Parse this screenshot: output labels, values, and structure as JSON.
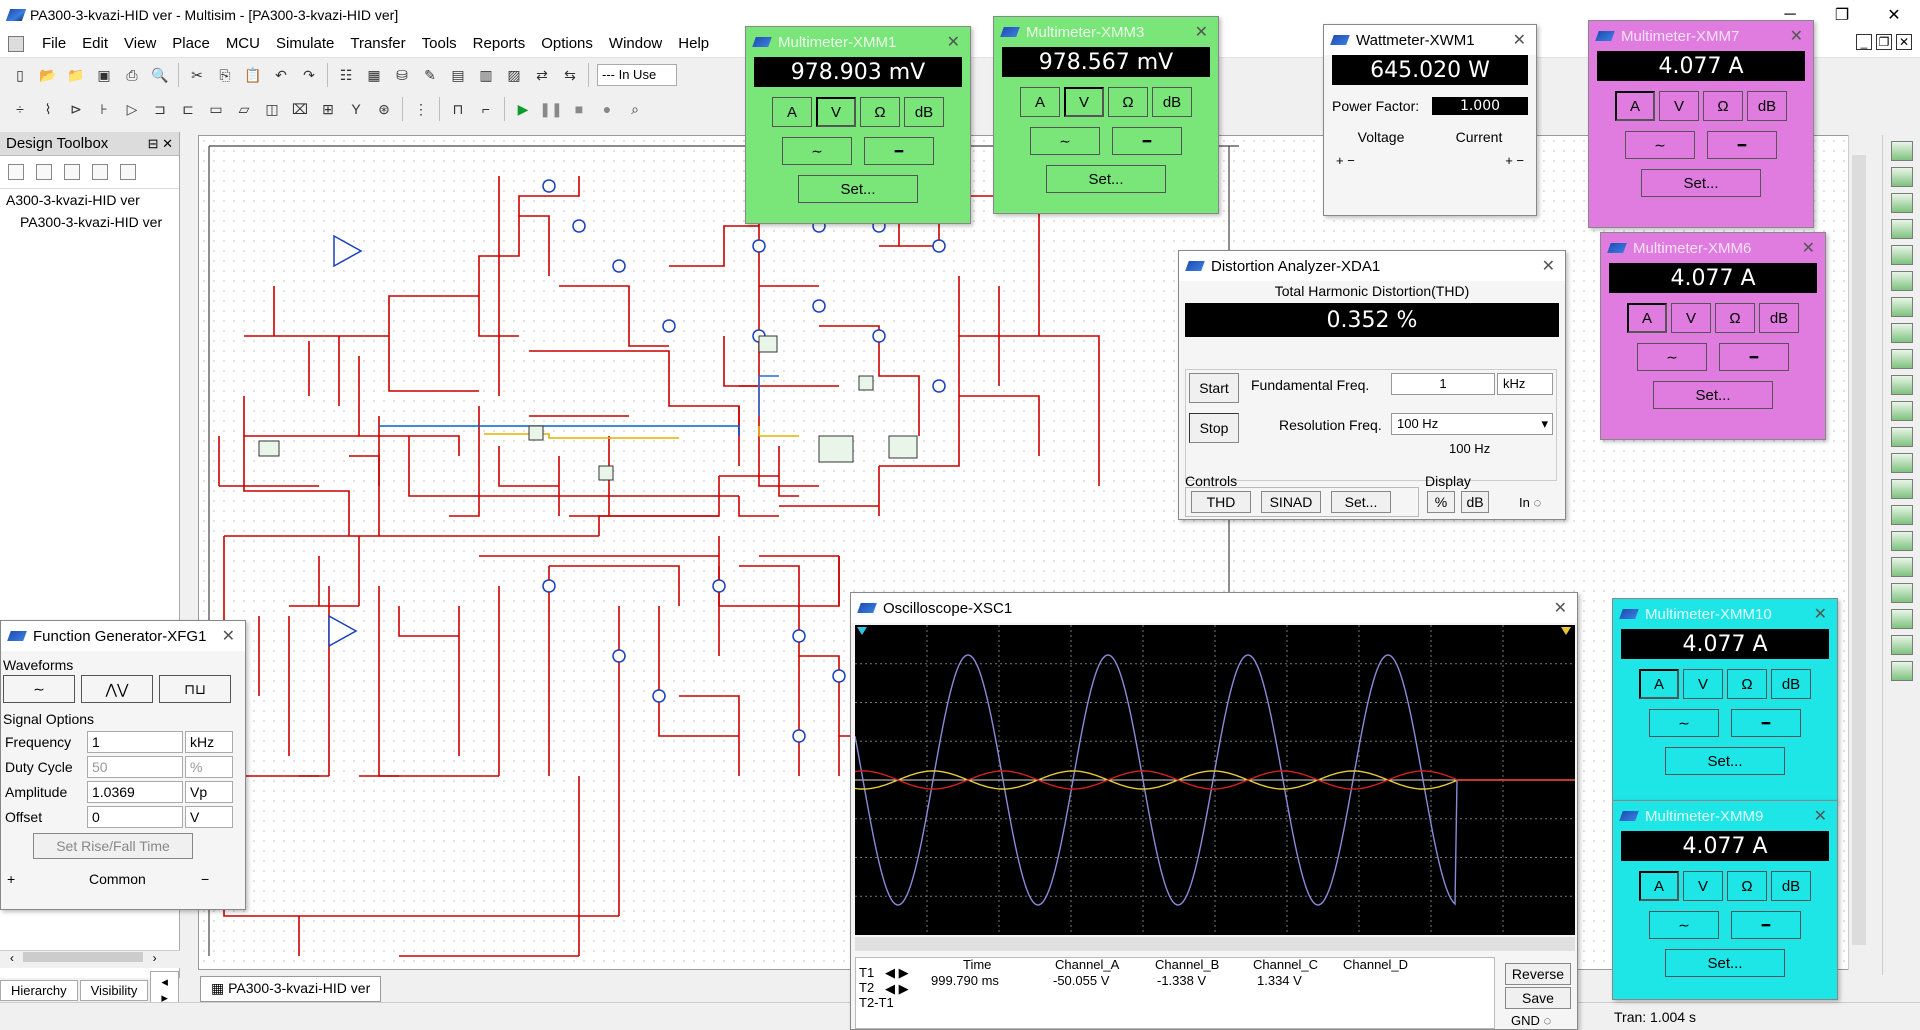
{
  "window": {
    "title": "PA300-3-kvazi-HID ver - Multisim - [PA300-3-kvazi-HID ver]"
  },
  "menu": [
    "File",
    "Edit",
    "View",
    "Place",
    "MCU",
    "Simulate",
    "Transfer",
    "Tools",
    "Reports",
    "Options",
    "Window",
    "Help"
  ],
  "toolbar": {
    "in_use": "--- In Use"
  },
  "toolbox": {
    "title": "Design Toolbox",
    "items": [
      "A300-3-kvazi-HID ver",
      "PA300-3-kvazi-HID ver"
    ],
    "tabs": [
      "Hierarchy",
      "Visibility"
    ]
  },
  "document_tab": "PA300-3-kvazi-HID ver",
  "status": {
    "tran": "Tran: 1.004 s"
  },
  "multimeters": {
    "xmm1": {
      "title": "Multimeter-XMM1",
      "reading": "978.903 mV",
      "set": "Set..."
    },
    "xmm3": {
      "title": "Multimeter-XMM3",
      "reading": "978.567 mV",
      "set": "Set..."
    },
    "xmm7": {
      "title": "Multimeter-XMM7",
      "reading": "4.077 A",
      "set": "Set..."
    },
    "xmm6": {
      "title": "Multimeter-XMM6",
      "reading": "4.077 A",
      "set": "Set..."
    },
    "xmm10": {
      "title": "Multimeter-XMM10",
      "reading": "4.077 A",
      "set": "Set..."
    },
    "xmm9": {
      "title": "Multimeter-XMM9",
      "reading": "4.077 A",
      "set": "Set..."
    },
    "mode_labels": [
      "A",
      "V",
      "Ω",
      "dB"
    ]
  },
  "wattmeter": {
    "title": "Wattmeter-XWM1",
    "reading": "645.020 W",
    "power_factor_label": "Power Factor:",
    "power_factor": "1.000",
    "voltage_label": "Voltage",
    "current_label": "Current"
  },
  "distortion": {
    "title": "Distortion Analyzer-XDA1",
    "thd_label": "Total Harmonic Distortion(THD)",
    "reading": "0.352 %",
    "start": "Start",
    "stop": "Stop",
    "fund_label": "Fundamental Freq.",
    "fund_value": "1",
    "fund_unit": "kHz",
    "res_label": "Resolution Freq.",
    "res_value": "100 Hz",
    "res_sub": "100 Hz",
    "controls_label": "Controls",
    "display_label": "Display",
    "thd_btn": "THD",
    "sinad_btn": "SINAD",
    "set_btn": "Set...",
    "pct_btn": "%",
    "db_btn": "dB",
    "in_label": "In"
  },
  "function_generator": {
    "title": "Function Generator-XFG1",
    "waveforms_label": "Waveforms",
    "signal_options_label": "Signal Options",
    "rows": [
      {
        "name": "Frequency",
        "value": "1",
        "unit": "kHz"
      },
      {
        "name": "Duty Cycle",
        "value": "50",
        "unit": "%"
      },
      {
        "name": "Amplitude",
        "value": "1.0369",
        "unit": "Vp"
      },
      {
        "name": "Offset",
        "value": "0",
        "unit": "V"
      }
    ],
    "rise_fall_btn": "Set Rise/Fall Time",
    "common_label": "Common"
  },
  "oscilloscope": {
    "title": "Oscilloscope-XSC1",
    "headers": [
      "Time",
      "Channel_A",
      "Channel_B",
      "Channel_C",
      "Channel_D"
    ],
    "t1_values": [
      "999.790 ms",
      "-50.055 V",
      "-1.338 V",
      "1.334 V",
      ""
    ],
    "row_labels": [
      "T1",
      "T2",
      "T2-T1"
    ],
    "buttons": [
      "Reverse",
      "Save"
    ],
    "gnd_label": "GND"
  },
  "colors": {
    "multimeter_green": "#7ae67a",
    "multimeter_magenta": "#e07ce0",
    "multimeter_cyan": "#1ee6e6",
    "schematic_wire": "#cc0000",
    "trace_a": "#8a8ad8",
    "trace_b": "#e6c93a",
    "trace_c": "#d02020"
  }
}
